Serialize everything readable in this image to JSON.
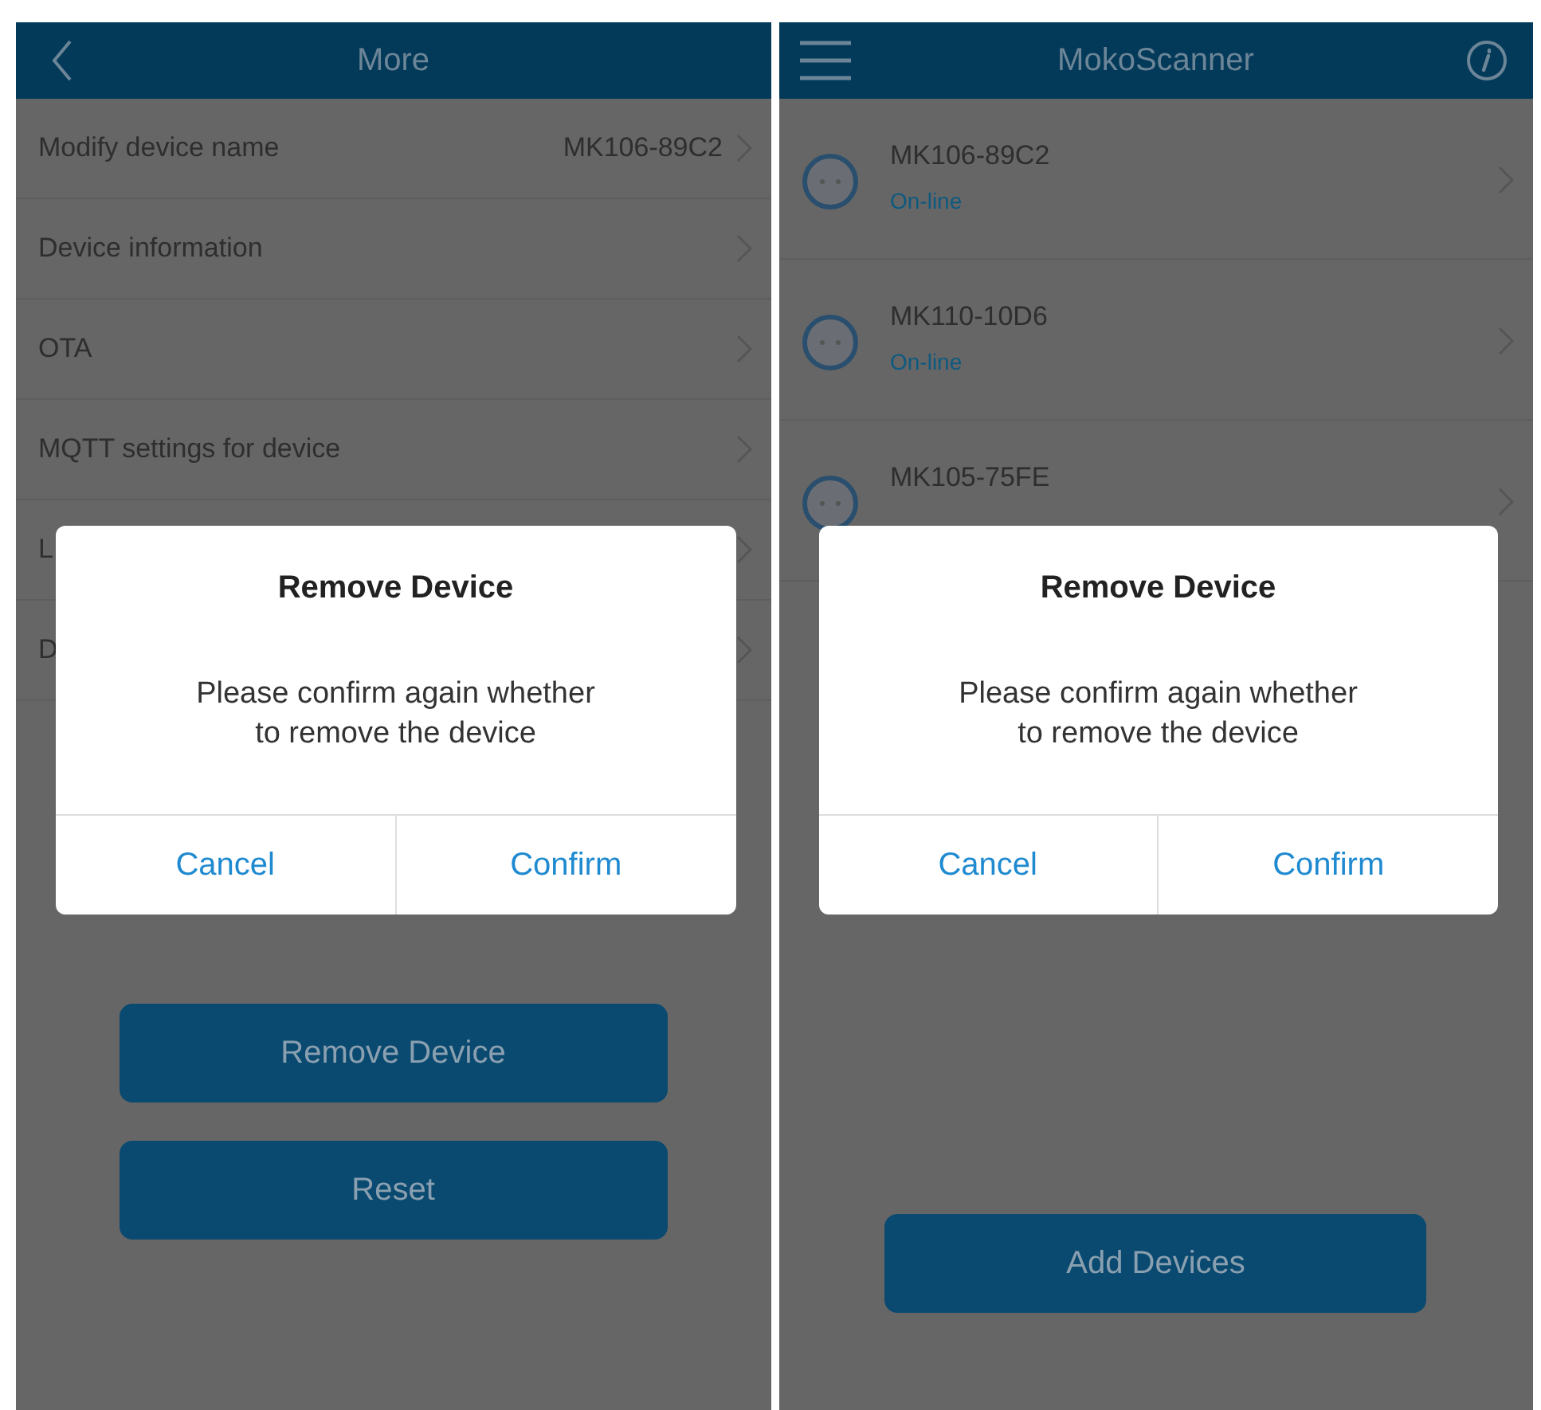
{
  "screens": [
    {
      "kind": "settings",
      "nav": {
        "title": "More",
        "left_icon": {
          "kind": "back"
        }
      },
      "rows": [
        {
          "label": "Modify device name",
          "value": "MK106-89C2"
        },
        {
          "label": "Device information"
        },
        {
          "label": "OTA"
        },
        {
          "label": "MQTT settings for device"
        },
        {
          "label": "L"
        },
        {
          "label": "D"
        }
      ],
      "buttons": [
        "Remove Device",
        "Reset"
      ],
      "dialog": {
        "title": "Remove Device",
        "message": "Please confirm again whether to remove the device",
        "buttons": [
          "Cancel",
          "Confirm"
        ]
      }
    },
    {
      "kind": "devices",
      "nav": {
        "title": "MokoScanner",
        "left_icon": {
          "kind": "menu"
        },
        "right_icon": {
          "kind": "info"
        }
      },
      "devices": [
        {
          "name": "MK106-89C2",
          "status": "On-line"
        },
        {
          "name": "MK110-10D6",
          "status": "On-line"
        },
        {
          "name": "MK105-75FE"
        }
      ],
      "buttons": [
        "Add Devices"
      ],
      "dialog": {
        "title": "Remove Device",
        "message": "Please confirm again whether to remove the device",
        "buttons": [
          "Cancel",
          "Confirm"
        ]
      }
    }
  ]
}
